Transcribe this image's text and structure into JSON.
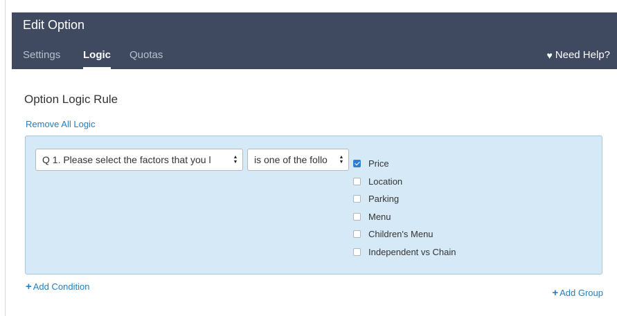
{
  "header": {
    "title": "Edit Option",
    "tabs": [
      {
        "label": "Settings",
        "active": false
      },
      {
        "label": "Logic",
        "active": true
      },
      {
        "label": "Quotas",
        "active": false
      }
    ],
    "help": {
      "icon": "heart-icon",
      "label": "Need Help?"
    }
  },
  "section": {
    "title": "Option Logic Rule",
    "remove_all_label": "Remove All Logic"
  },
  "rule": {
    "question_select": "Q 1. Please select the factors that you l",
    "operator_select": "is one of the follo",
    "options": [
      {
        "label": "Price",
        "checked": true
      },
      {
        "label": "Location",
        "checked": false
      },
      {
        "label": "Parking",
        "checked": false
      },
      {
        "label": "Menu",
        "checked": false
      },
      {
        "label": "Children's Menu",
        "checked": false
      },
      {
        "label": "Independent vs Chain",
        "checked": false
      }
    ]
  },
  "actions": {
    "add_condition_label": "Add Condition",
    "add_group_label": "Add Group"
  },
  "colors": {
    "header_bg": "#3f4a61",
    "rule_bg": "#d6e9f7",
    "link": "#1f7fc2",
    "checkbox_checked": "#2d7fd3"
  }
}
